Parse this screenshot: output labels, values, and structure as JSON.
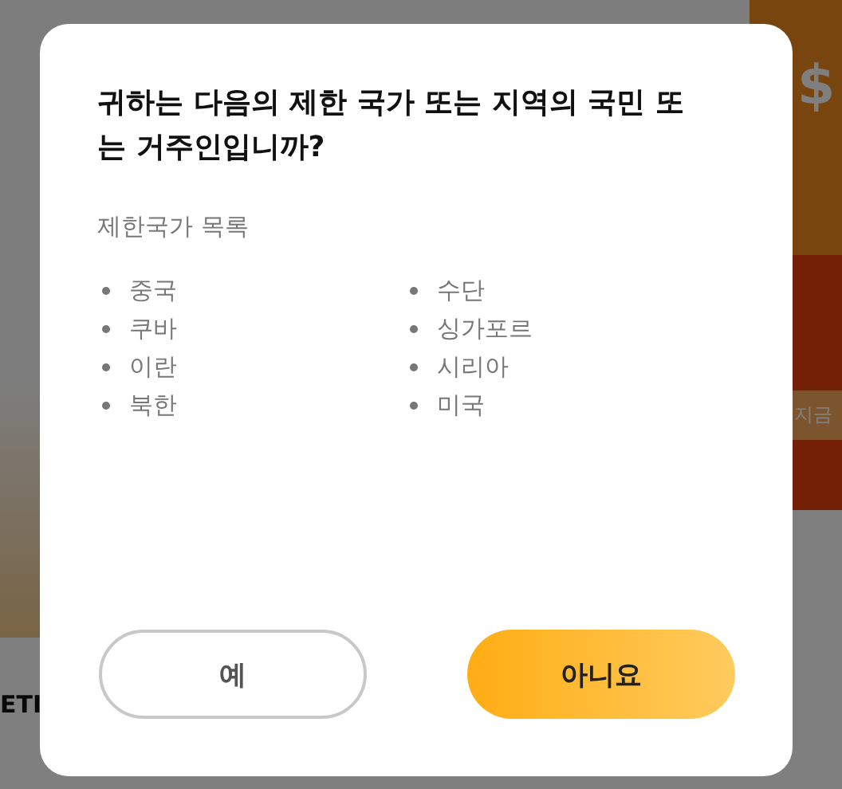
{
  "background": {
    "banner_symbol": "$",
    "banner_button": "지금",
    "bottom_text": "ETI"
  },
  "dialog": {
    "title": "귀하는 다음의 제한 국가 또는 지역의 국민 또는 거주인입니까?",
    "list_heading": "제한국가 목록",
    "countries": [
      "중국",
      "쿠바",
      "이란",
      "북한",
      "수단",
      "싱가포르",
      "시리아",
      "미국"
    ],
    "buttons": [
      {
        "label": "예",
        "kind": "secondary"
      },
      {
        "label": "아니요",
        "kind": "primary"
      }
    ]
  }
}
